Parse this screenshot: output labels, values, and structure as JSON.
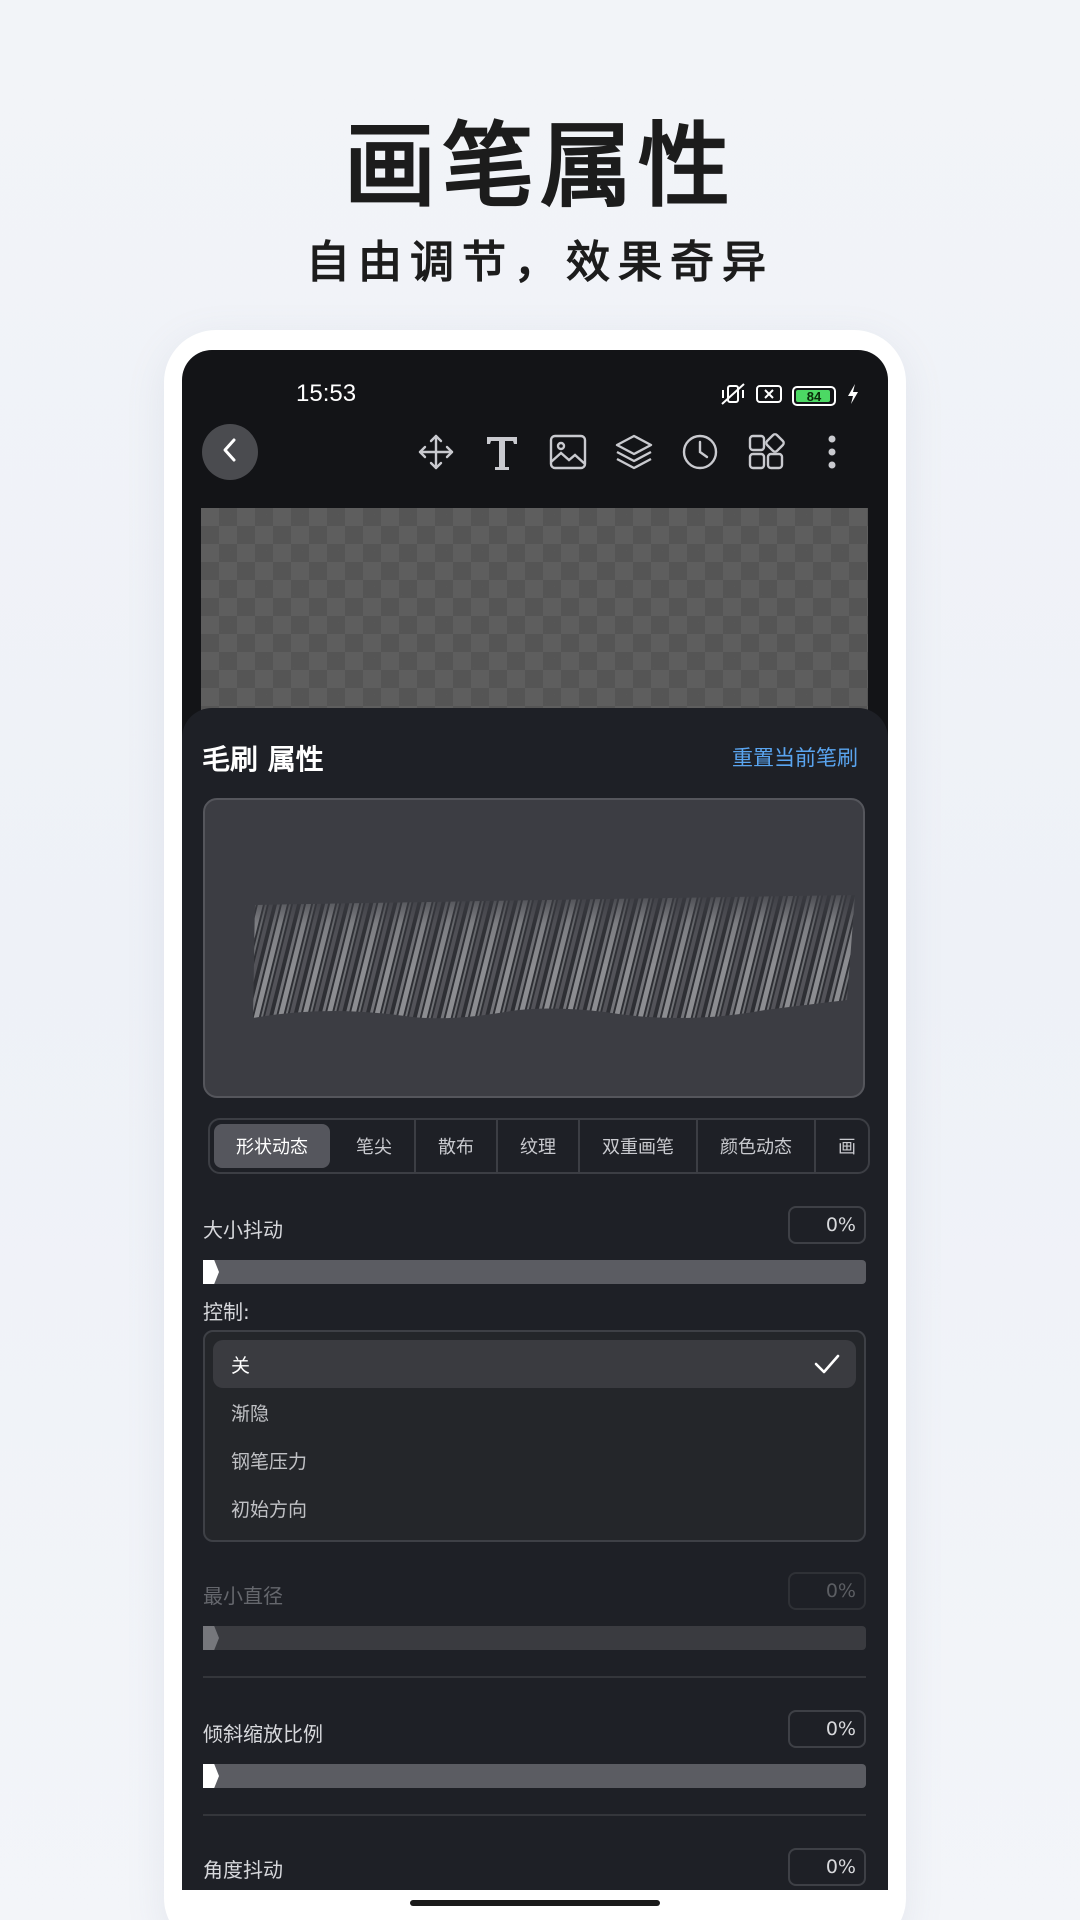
{
  "promo": {
    "headline": "画笔属性",
    "subline": "自由调节，效果奇异"
  },
  "status_bar": {
    "time": "15:53",
    "battery_level": "84",
    "icons": [
      "vibrate-mute-icon",
      "sim-off-icon",
      "battery-icon",
      "charging-icon"
    ]
  },
  "toolbar": {
    "back_icon": "chevron-left-icon",
    "tools": [
      "move-icon",
      "text-icon",
      "image-icon",
      "layers-icon",
      "history-icon",
      "grid-icon",
      "more-vertical-icon"
    ]
  },
  "panel": {
    "title": "毛刷 属性",
    "reset_label": "重置当前笔刷"
  },
  "tabs": [
    "形状动态",
    "笔尖",
    "散布",
    "纹理",
    "双重画笔",
    "颜色动态",
    "画"
  ],
  "active_tab": 0,
  "size_jitter": {
    "label": "大小抖动",
    "value": "0%",
    "level": 0
  },
  "control": {
    "label": "控制:",
    "options": [
      "关",
      "渐隐",
      "钢笔压力",
      "初始方向"
    ],
    "selected": 0
  },
  "min_diameter": {
    "label": "最小直径",
    "value": "0%",
    "level": 0
  },
  "tilt_scale": {
    "label": "倾斜缩放比例",
    "value": "0%",
    "level": 0
  },
  "angle_jitter": {
    "label": "角度抖动",
    "value": "0%"
  },
  "colors": {
    "accent": "#5aa5f0",
    "panel_bg": "#1e2026",
    "screen_bg": "#131417"
  }
}
